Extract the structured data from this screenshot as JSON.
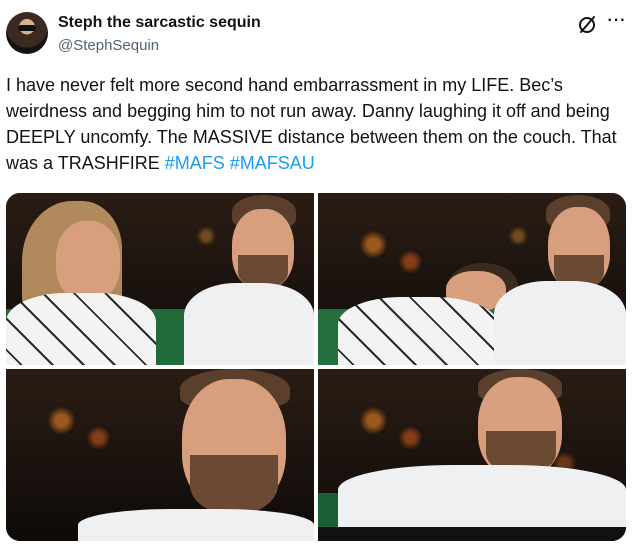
{
  "author": {
    "display_name": "Steph the sarcastic sequin",
    "handle": "@StephSequin"
  },
  "header_icons": [
    "grok-icon",
    "more-icon"
  ],
  "more_label": "···",
  "tweet": {
    "text_main": "I have never felt more second hand embarrassment in my LIFE. Bec’s weirdness and begging him to not run away. Danny laughing it off and being DEEPLY uncomfy. The MASSIVE distance between them on the couch. That was a TRASHFIRE ",
    "hashtags": [
      "#MAFS",
      "#MAFSAU"
    ]
  },
  "colors": {
    "text_primary": "#0f1419",
    "text_secondary": "#536471",
    "link": "#1d9bf0",
    "background": "#ffffff"
  },
  "media": {
    "count": 4,
    "frames": [
      {
        "scene": "woman-and-man-on-couch"
      },
      {
        "scene": "woman-covering-face-man-smiling"
      },
      {
        "scene": "man-closeup"
      },
      {
        "scene": "man-reclining-on-tv-screen"
      }
    ]
  }
}
